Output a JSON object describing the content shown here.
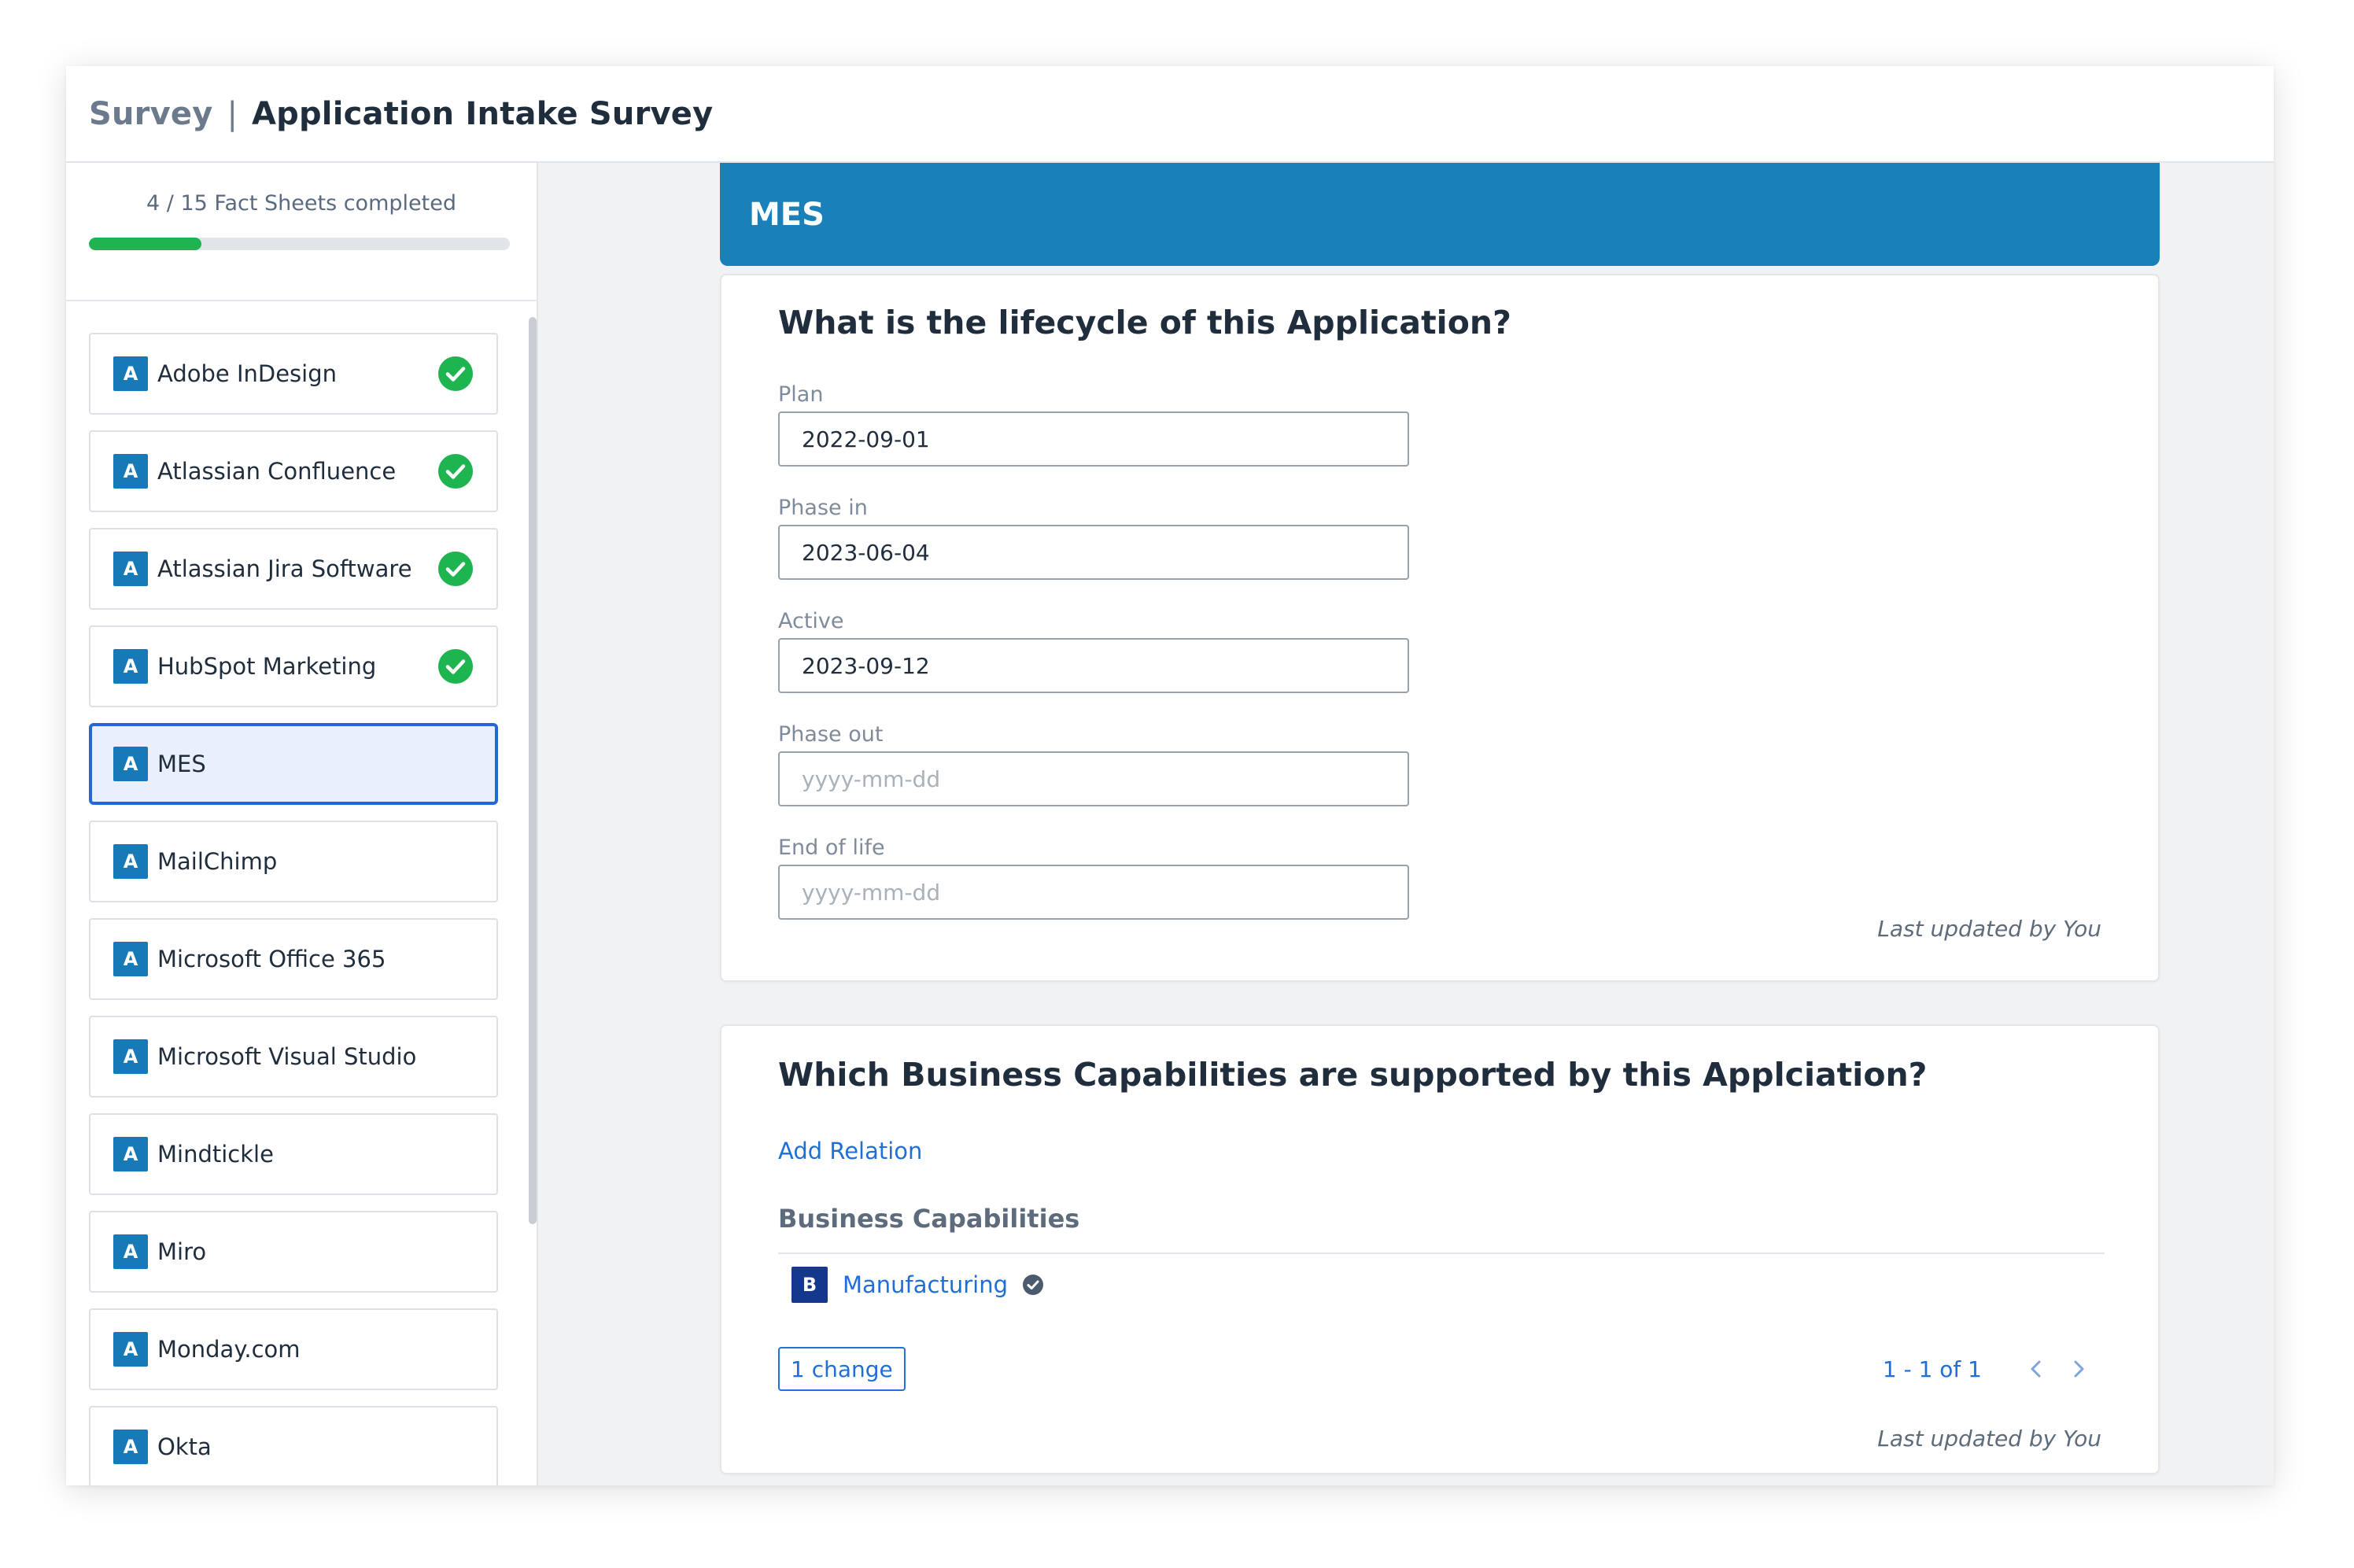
{
  "header": {
    "section": "Survey",
    "separator": "|",
    "title": "Application Intake Survey"
  },
  "progress": {
    "text": "4 / 15 Fact Sheets completed",
    "completed": 4,
    "total": 15,
    "fraction": 0.2667
  },
  "sidebar": {
    "items": [
      {
        "badge": "A",
        "label": "Adobe InDesign",
        "completed": true
      },
      {
        "badge": "A",
        "label": "Atlassian Confluence",
        "completed": true
      },
      {
        "badge": "A",
        "label": "Atlassian Jira Software",
        "completed": true
      },
      {
        "badge": "A",
        "label": "HubSpot Marketing",
        "completed": true
      },
      {
        "badge": "A",
        "label": "MES",
        "completed": false,
        "selected": true
      },
      {
        "badge": "A",
        "label": "MailChimp",
        "completed": false
      },
      {
        "badge": "A",
        "label": "Microsoft Office 365",
        "completed": false
      },
      {
        "badge": "A",
        "label": "Microsoft Visual Studio",
        "completed": false
      },
      {
        "badge": "A",
        "label": "Mindtickle",
        "completed": false
      },
      {
        "badge": "A",
        "label": "Miro",
        "completed": false
      },
      {
        "badge": "A",
        "label": "Monday.com",
        "completed": false
      },
      {
        "badge": "A",
        "label": "Okta",
        "completed": false
      }
    ]
  },
  "main": {
    "banner_title": "MES",
    "lifecycle": {
      "question": "What is the lifecycle of this Application?",
      "fields": [
        {
          "label": "Plan",
          "value": "2022-09-01",
          "placeholder": "yyyy-mm-dd"
        },
        {
          "label": "Phase in",
          "value": "2023-06-04",
          "placeholder": "yyyy-mm-dd"
        },
        {
          "label": "Active",
          "value": "2023-09-12",
          "placeholder": "yyyy-mm-dd"
        },
        {
          "label": "Phase out",
          "value": "",
          "placeholder": "yyyy-mm-dd"
        },
        {
          "label": "End of life",
          "value": "",
          "placeholder": "yyyy-mm-dd"
        }
      ],
      "last_updated": "Last updated by You"
    },
    "capabilities": {
      "question": "Which Business Capabilities are supported by this Applciation?",
      "add_relation": "Add Relation",
      "section_title": "Business Capabilities",
      "items": [
        {
          "badge": "B",
          "label": "Manufacturing"
        }
      ],
      "change_button": "1 change",
      "pagination": "1 - 1 of 1",
      "last_updated": "Last updated by You"
    }
  },
  "colors": {
    "accent": "#1a80b9",
    "badge_application": "#1779b6",
    "badge_capability": "#15378e",
    "success": "#1eb550",
    "link": "#1f6fd6",
    "selected_border": "#2466d8"
  },
  "icons": {
    "completed": "check-circle-icon",
    "verified": "verified-check-icon",
    "prev": "chevron-left-icon",
    "next": "chevron-right-icon"
  }
}
